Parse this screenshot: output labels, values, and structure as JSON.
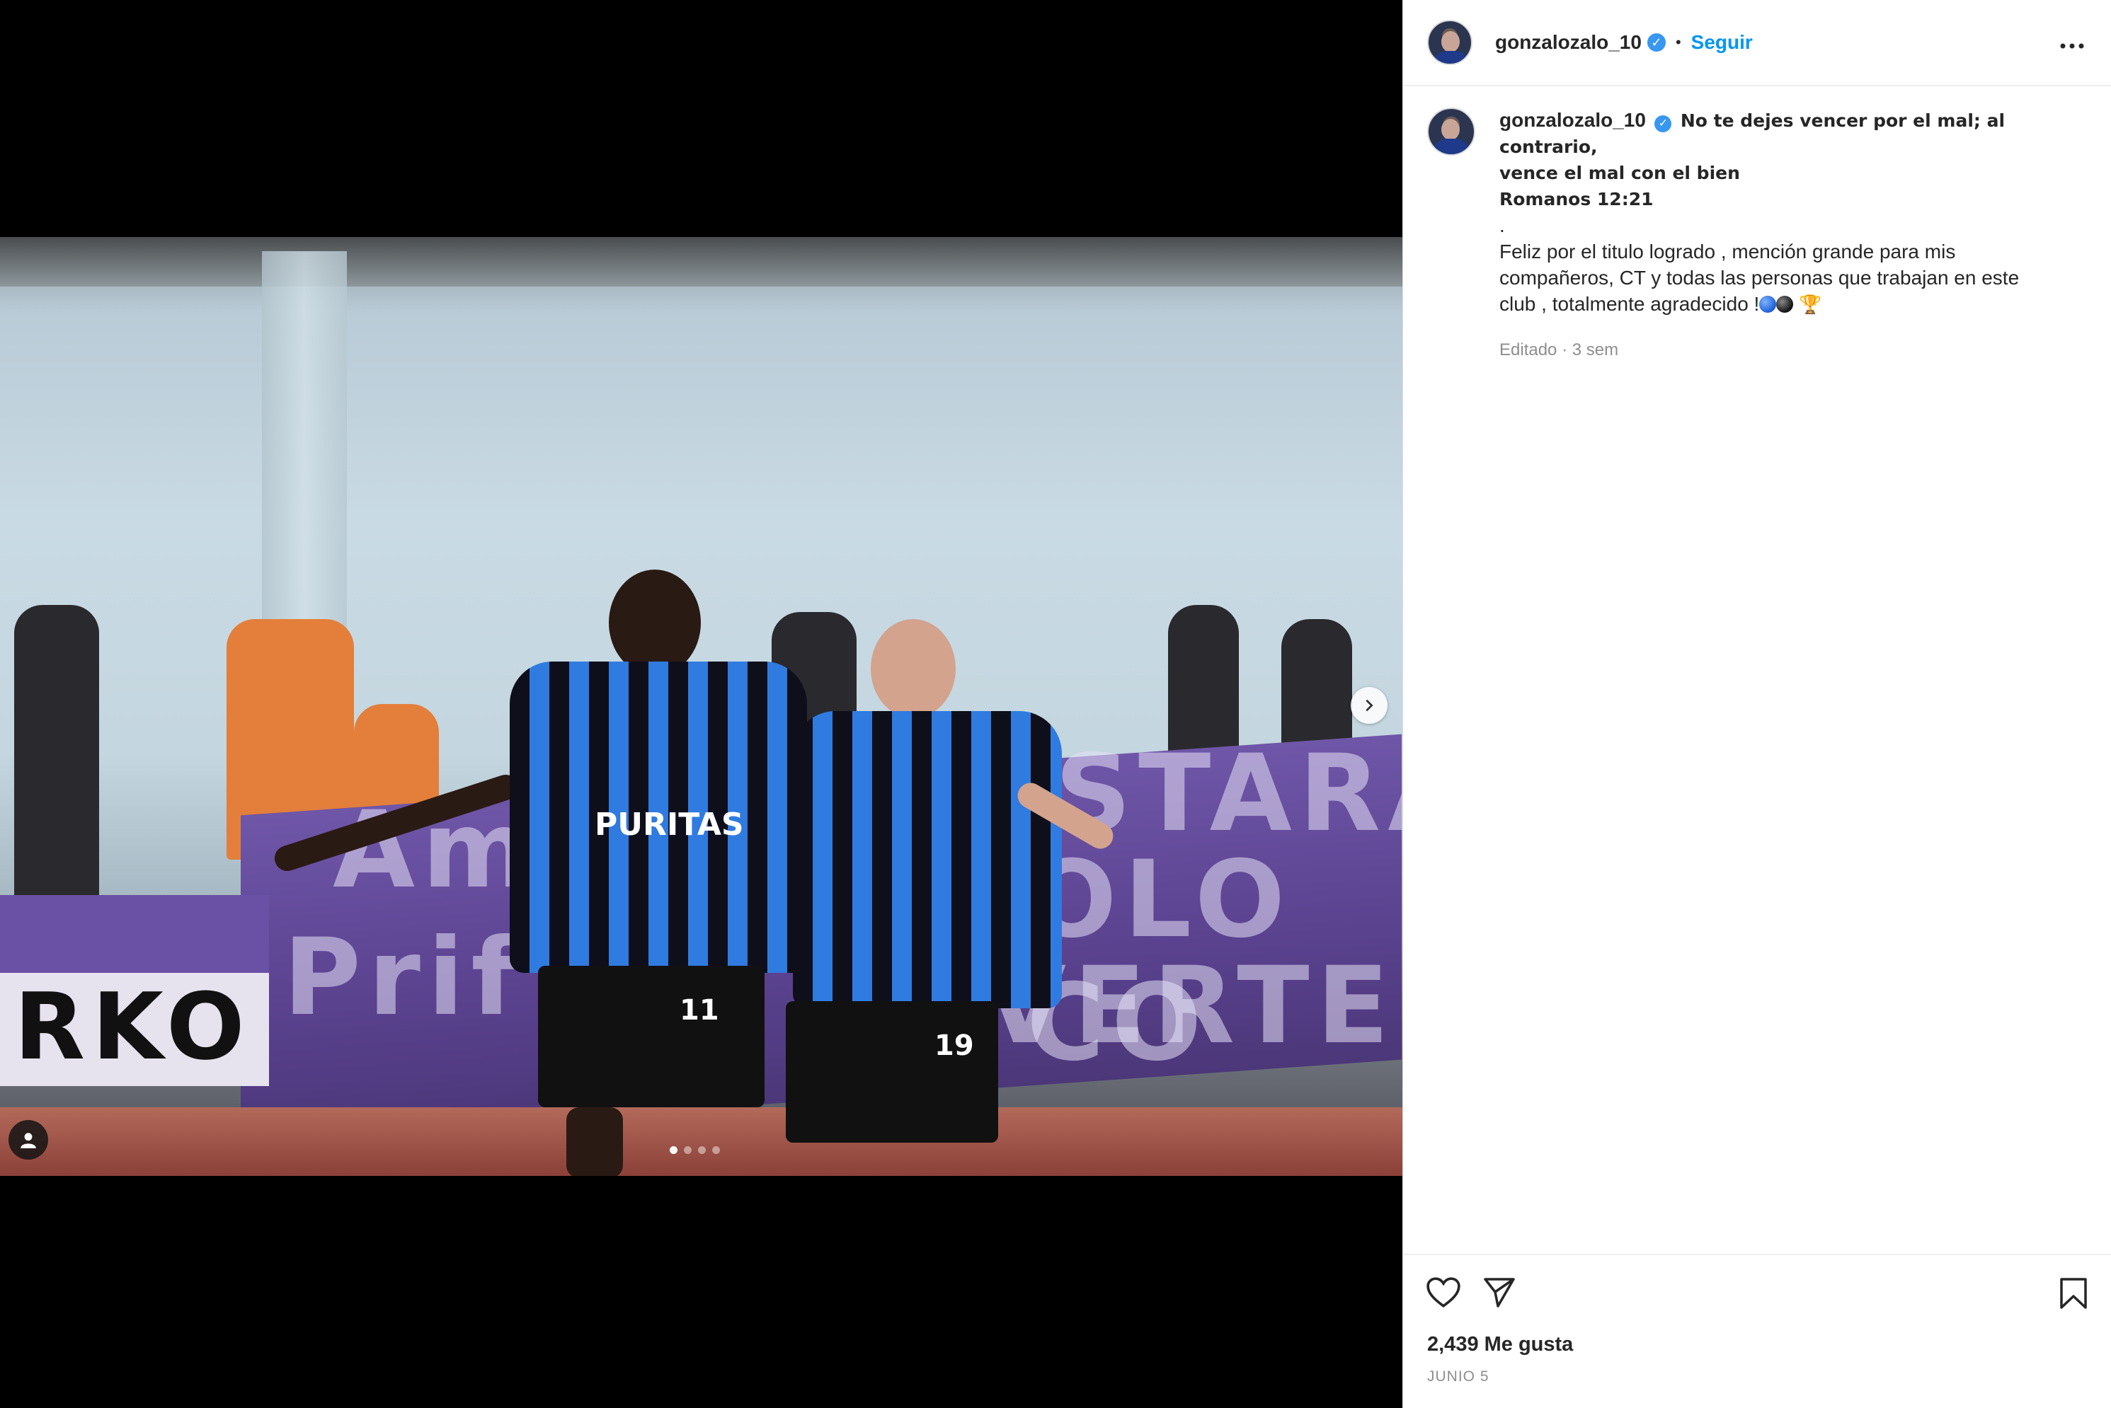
{
  "post": {
    "username": "gonzalozalo_10",
    "verified": true,
    "follow_label": "Seguir",
    "separator": "•",
    "more_label": "...",
    "caption": {
      "lead_line_1": "No te dejes vencer por el mal; al contrario,",
      "lead_line_2": "vence el mal con el bien",
      "reference": "Romanos 12:21",
      "dot": ".",
      "line_1": "Feliz por el titulo logrado , mención grande para mis",
      "line_2": "compañeros, CT y todas las personas que trabajan en este",
      "line_3": "club , totalmente agradecido !",
      "edited_label": "Editado",
      "time_ago": "3 sem",
      "meta_sep": " · "
    },
    "likes_text": "2,439 Me gusta",
    "date_text": "JUNIO 5"
  },
  "media": {
    "carousel_total": 4,
    "carousel_active": 1,
    "sponsor_text": "PURITAS",
    "banner_text_1": "Ami",
    "banner_text_2": "STARA",
    "banner_text_3": "OLO CO",
    "banner_text_4": "VERTE",
    "banner_text_5": "Prif",
    "banner_left_text": "RKO",
    "jersey_number_1": "11",
    "jersey_number_2": "19"
  },
  "icons": {
    "like": "heart-icon",
    "share": "send-icon",
    "save": "bookmark-icon",
    "next": "chevron-right-icon",
    "tags": "user-icon",
    "verified": "verified-badge-icon",
    "more": "more-horizontal-icon"
  },
  "colors": {
    "accent": "#0095f6",
    "verified": "#3897f0",
    "text": "#262626",
    "muted": "#8e8e8e",
    "jersey_blue": "#2f7be0"
  }
}
